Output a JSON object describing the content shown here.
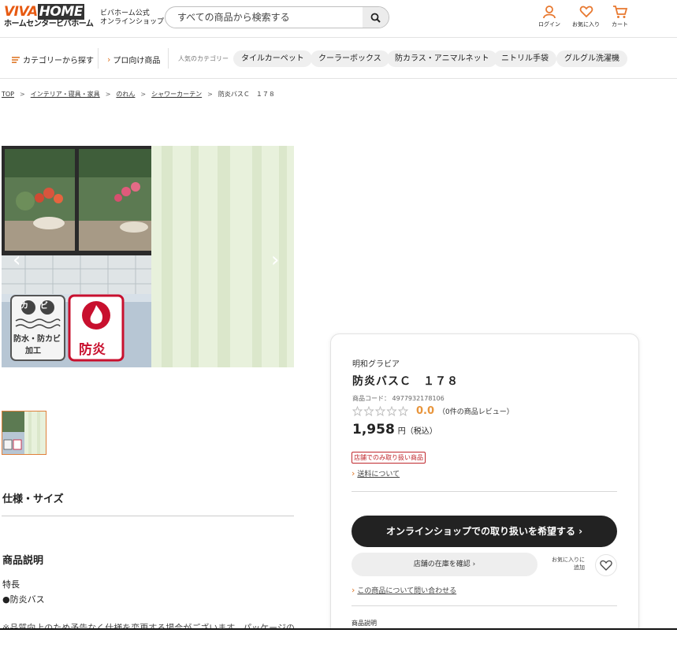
{
  "header": {
    "logo_top_viva": "VIVA",
    "logo_top_home": "HOME",
    "logo_bottom": "ホームセンタービバホーム",
    "logo_sub_line1": "ビバホーム公式",
    "logo_sub_line2": "オンラインショップ",
    "search_placeholder": "すべての商品から検索する",
    "login_label": "ログイン",
    "favorites_label": "お気に入り",
    "cart_label": "カート",
    "accent_color": "#e8782f"
  },
  "nav": {
    "category_link": "カテゴリーから探す",
    "pro_link": "プロ向け商品",
    "popular_label": "人気のカテゴリー",
    "chips": [
      "タイルカーペット",
      "クーラーボックス",
      "防カラス・アニマルネット",
      "ニトリル手袋",
      "グルグル洗濯機"
    ]
  },
  "breadcrumb": {
    "items": [
      "TOP",
      "インテリア・寝具・家具",
      "のれん",
      "シャワーカーテン"
    ],
    "current": "防炎バスＣ　１７８",
    "separator": ">"
  },
  "gallery": {
    "badge_kabi_1": "カ",
    "badge_kabi_2": "ビ",
    "badge_kabi_text1": "防水・防カビ",
    "badge_kabi_text2": "加工",
    "badge_fire_text": "防炎",
    "prev_arrow": "‹",
    "next_arrow": "›"
  },
  "left": {
    "spec_title": "仕様・サイズ",
    "desc_title": "商品説明",
    "feature_label": "特長",
    "feature_item": "●防炎バス",
    "notice": "※品質向上のため予告なく仕様を変更する場合がございます。パッケージの"
  },
  "product": {
    "brand": "明和グラビア",
    "name": "防炎バスＣ　１７８",
    "code_label": "商品コード：",
    "code": "4977932178106",
    "rating_value": "0.0",
    "rating_stars": 0,
    "review_text": "（0件の商品レビュー）",
    "price": "1,958",
    "price_unit": "円（税込）",
    "store_only_badge": "店舗でのみ取り扱い商品",
    "shipping_link": "送料について",
    "request_button": "オンラインショップでの取り扱いを希望する ›",
    "stock_button": "店舗の在庫を確認 ›",
    "fav_label_line1": "お気に入りに",
    "fav_label_line2": "追加",
    "inquiry_link": "この商品について問い合わせる",
    "desc_heading": "商品説明"
  }
}
